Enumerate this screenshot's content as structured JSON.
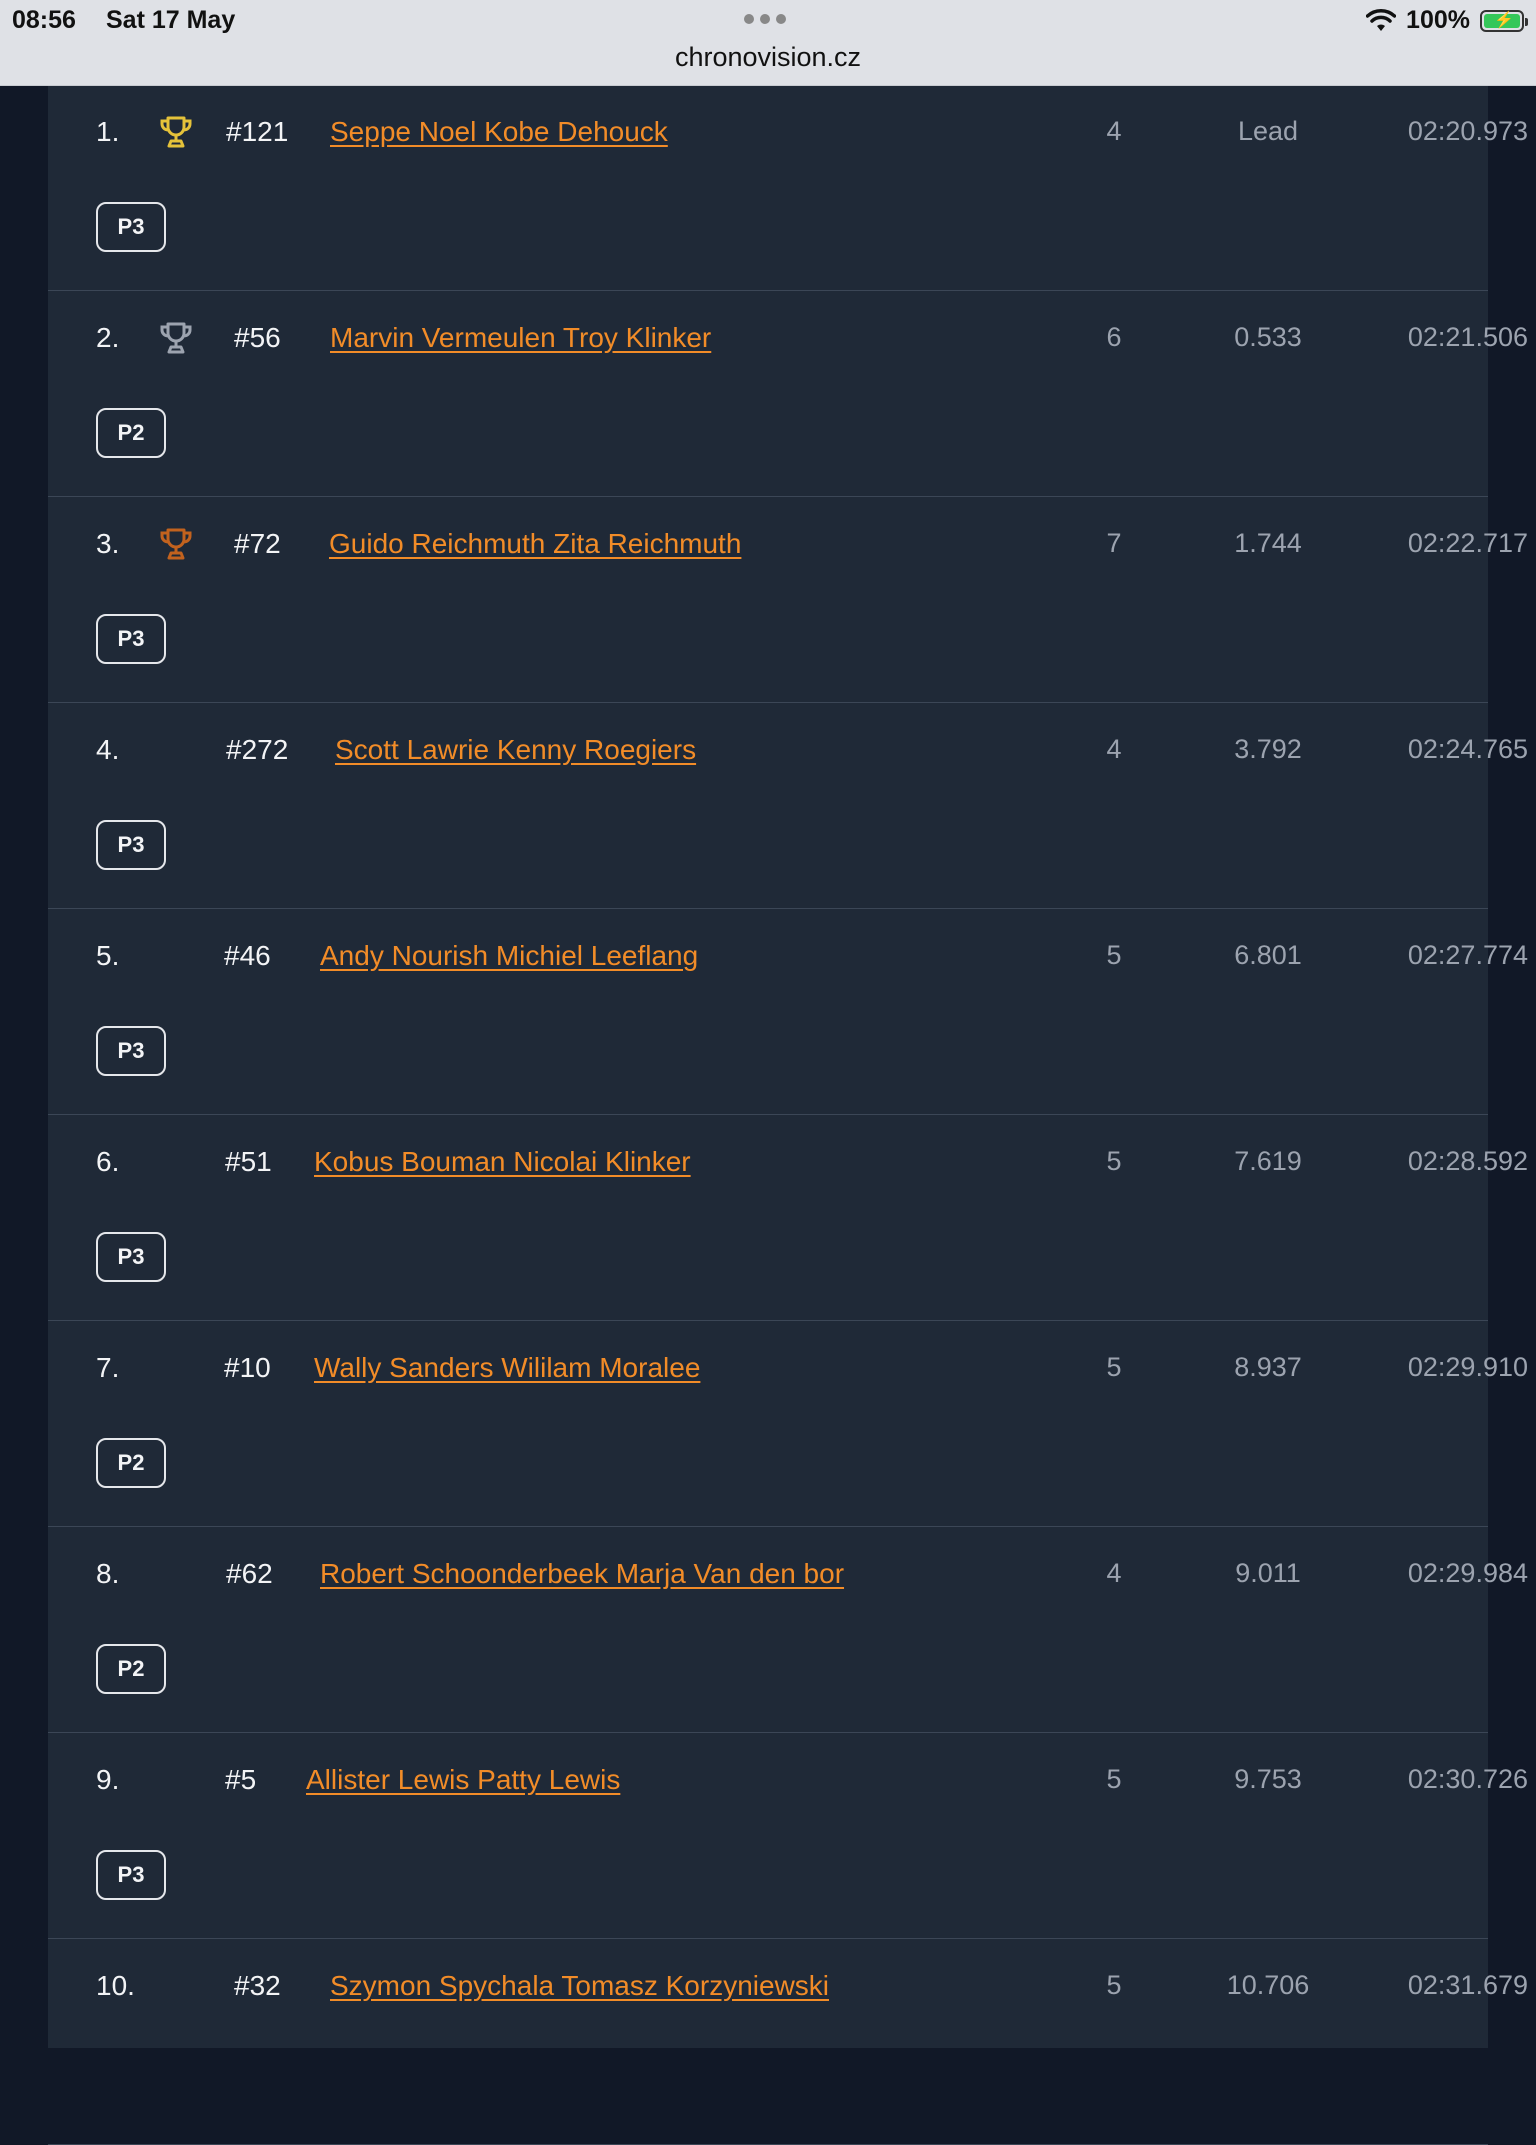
{
  "status": {
    "time": "08:56",
    "date": "Sat 17 May",
    "battery": "100%",
    "url": "chronovision.cz"
  },
  "colors": {
    "accent": "#f28c28",
    "gold": "#e5c23a",
    "silver": "#9ca3af",
    "bronze": "#c2621e"
  },
  "results": [
    {
      "pos": "1.",
      "trophy": "gold",
      "num": "#121",
      "name": "Seppe Noel Kobe Dehouck",
      "laps": "4",
      "gap": "Lead",
      "time": "02:20.973",
      "class": "P3"
    },
    {
      "pos": "2.",
      "trophy": "silver",
      "num": "#56",
      "name": "Marvin Vermeulen Troy Klinker",
      "laps": "6",
      "gap": "0.533",
      "time": "02:21.506",
      "class": "P2"
    },
    {
      "pos": "3.",
      "trophy": "bronze",
      "num": "#72",
      "name": "Guido Reichmuth Zita Reichmuth",
      "laps": "7",
      "gap": "1.744",
      "time": "02:22.717",
      "class": "P3"
    },
    {
      "pos": "4.",
      "trophy": "",
      "num": "#272",
      "name": "Scott Lawrie Kenny Roegiers",
      "laps": "4",
      "gap": "3.792",
      "time": "02:24.765",
      "class": "P3"
    },
    {
      "pos": "5.",
      "trophy": "",
      "num": "#46",
      "name": "Andy Nourish Michiel Leeflang",
      "laps": "5",
      "gap": "6.801",
      "time": "02:27.774",
      "class": "P3"
    },
    {
      "pos": "6.",
      "trophy": "",
      "num": "#51",
      "name": "Kobus Bouman Nicolai Klinker",
      "laps": "5",
      "gap": "7.619",
      "time": "02:28.592",
      "class": "P3"
    },
    {
      "pos": "7.",
      "trophy": "",
      "num": "#10",
      "name": "Wally Sanders Wililam Moralee",
      "laps": "5",
      "gap": "8.937",
      "time": "02:29.910",
      "class": "P2"
    },
    {
      "pos": "8.",
      "trophy": "",
      "num": "#62",
      "name": "Robert Schoonderbeek Marja Van den bor",
      "laps": "4",
      "gap": "9.011",
      "time": "02:29.984",
      "class": "P2"
    },
    {
      "pos": "9.",
      "trophy": "",
      "num": "#5",
      "name": "Allister Lewis Patty Lewis",
      "laps": "5",
      "gap": "9.753",
      "time": "02:30.726",
      "class": "P3"
    },
    {
      "pos": "10.",
      "trophy": "",
      "num": "#32",
      "name": "Szymon Spychala Tomasz Korzyniewski",
      "laps": "5",
      "gap": "10.706",
      "time": "02:31.679",
      "class": ""
    }
  ]
}
